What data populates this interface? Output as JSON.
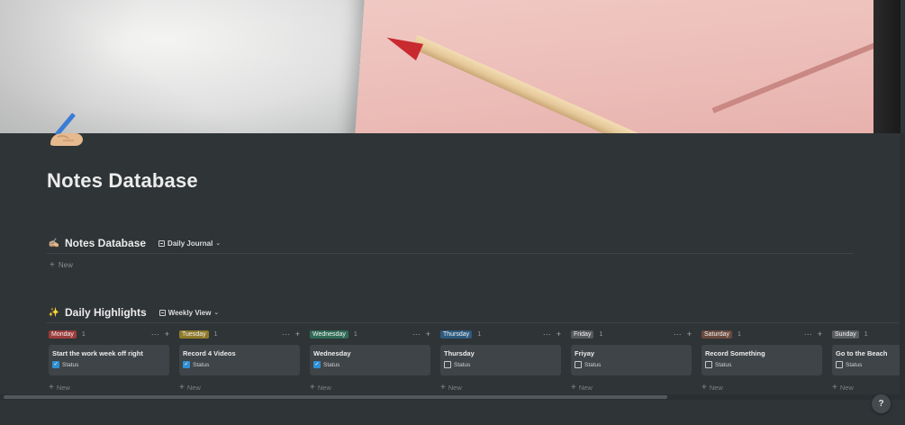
{
  "page": {
    "title": "Notes Database",
    "icon": "writing-hand-emoji"
  },
  "notes_section": {
    "emoji": "✍🏼",
    "title": "Notes Database",
    "view_label": "Daily Journal",
    "new_label": "New"
  },
  "highlights_section": {
    "emoji": "✨",
    "title": "Daily Highlights",
    "view_label": "Weekly View"
  },
  "board": {
    "more_glyph": "···",
    "add_glyph": "+",
    "new_label": "New",
    "columns": [
      {
        "day": "Monday",
        "color": "#9b3d3a",
        "count": "1",
        "card_title": "Start the work week off right",
        "status_label": "Status",
        "checked": true
      },
      {
        "day": "Tuesday",
        "color": "#8f7a2a",
        "count": "1",
        "card_title": "Record 4 Videos",
        "status_label": "Status",
        "checked": true
      },
      {
        "day": "Wednesday",
        "color": "#2f6a55",
        "count": "1",
        "card_title": "Wednesday",
        "status_label": "Status",
        "checked": true
      },
      {
        "day": "Thursday",
        "color": "#2d5a7e",
        "count": "1",
        "card_title": "Thursday",
        "status_label": "Status",
        "checked": false
      },
      {
        "day": "Friday",
        "color": "#55595c",
        "count": "1",
        "card_title": "Friyay",
        "status_label": "Status",
        "checked": false
      },
      {
        "day": "Saturday",
        "color": "#6b4a3d",
        "count": "1",
        "card_title": "Record Something",
        "status_label": "Status",
        "checked": false
      },
      {
        "day": "Sunday",
        "color": "#5a5e61",
        "count": "1",
        "card_title": "Go to the Beach",
        "status_label": "Status",
        "checked": false
      }
    ]
  },
  "help": {
    "label": "?"
  }
}
